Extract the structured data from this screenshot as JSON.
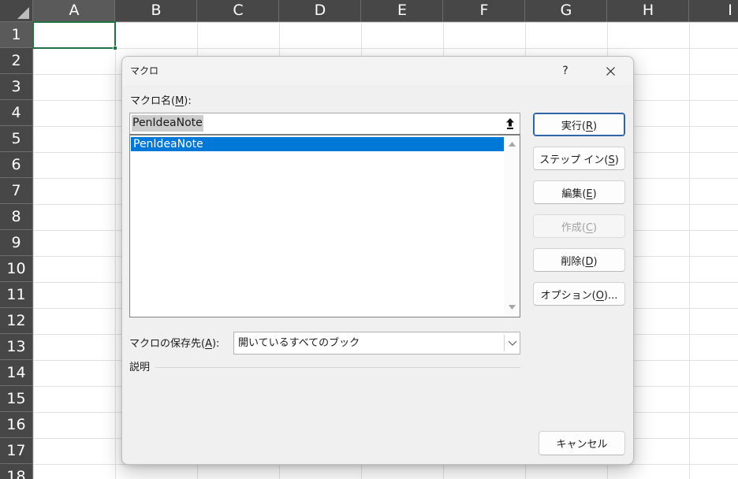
{
  "sheet": {
    "columns": [
      "A",
      "B",
      "C",
      "D",
      "E",
      "F",
      "G",
      "H",
      "I"
    ],
    "rows": [
      "1",
      "2",
      "3",
      "4",
      "5",
      "6",
      "7",
      "8",
      "9",
      "10",
      "11",
      "12",
      "13",
      "14",
      "15",
      "16",
      "17",
      "18"
    ],
    "active_cell": {
      "column": 0,
      "row": 0
    }
  },
  "dialog": {
    "title": "マクロ",
    "help_label": "?",
    "macro_name": {
      "label": "マクロ名(M):",
      "value": "PenIdeaNote"
    },
    "macro_list": {
      "items": [
        {
          "label": "PenIdeaNote",
          "selected": true
        }
      ]
    },
    "location": {
      "label": "マクロの保存先(A):",
      "selected": "開いているすべてのブック"
    },
    "description": {
      "label": "説明"
    },
    "buttons": [
      {
        "label": "実行(R)",
        "default": true,
        "enabled": true
      },
      {
        "label": "ステップ イン(S)",
        "default": false,
        "enabled": true
      },
      {
        "label": "編集(E)",
        "default": false,
        "enabled": true
      },
      {
        "label": "作成(C)",
        "default": false,
        "enabled": false
      },
      {
        "label": "削除(D)",
        "default": false,
        "enabled": true
      },
      {
        "label": "オプション(O)...",
        "default": false,
        "enabled": true
      }
    ],
    "cancel": {
      "label": "キャンセル"
    }
  },
  "icons": {
    "select_all": "select-all-triangle-icon",
    "close": "close-icon",
    "refedit": "up-arrow-bar-icon",
    "scroll_up": "scroll-up-arrow-icon",
    "scroll_down": "scroll-down-arrow-icon",
    "dropdown": "chevron-down-icon"
  },
  "colors": {
    "header_bg": "#474747",
    "header_selected_bg": "#5a5a5a",
    "header_line": "#6e6e6e",
    "header_text": "#ffffff",
    "gridline": "#e1e1e1",
    "active_cell_border": "#217346",
    "dialog_bg": "#f0f0f0",
    "titlebar_bg": "#f3f3f3",
    "list_selection_bg": "#0078d7",
    "list_selection_text": "#ffffff",
    "text_selection_bg": "#cccccc",
    "default_button_border": "#2f65a8",
    "disabled_text": "#a0a0a0"
  }
}
